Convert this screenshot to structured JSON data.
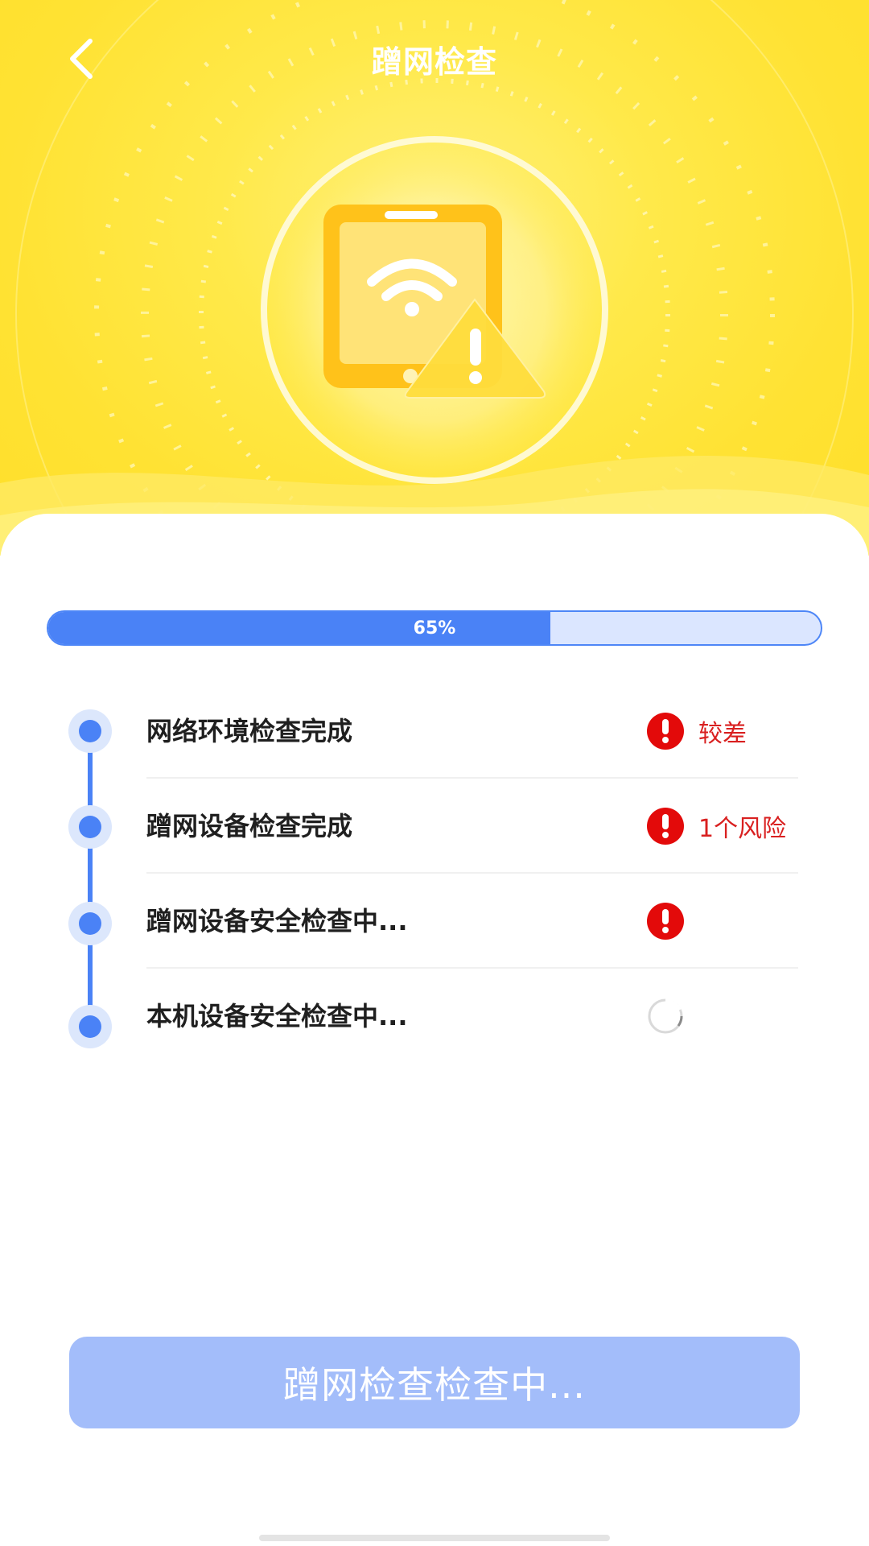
{
  "header": {
    "title": "蹭网检查",
    "back_icon": "chevron-left-icon"
  },
  "hero": {
    "icon": "phone-wifi-warning-icon",
    "colors": {
      "phone": "#ffc21a",
      "screen": "#ffe377",
      "warning": "#ffdc3c"
    }
  },
  "progress": {
    "value": 65,
    "label": "65%",
    "fill_color": "#4a82f6",
    "track_color": "#dbe6ff"
  },
  "checks": [
    {
      "label": "网络环境检查完成",
      "status": "warning",
      "status_text": "较差"
    },
    {
      "label": "蹭网设备检查完成",
      "status": "warning",
      "status_text": "1个风险"
    },
    {
      "label": "蹭网设备安全检查中...",
      "status": "warning",
      "status_text": ""
    },
    {
      "label": "本机设备安全检查中...",
      "status": "loading",
      "status_text": ""
    }
  ],
  "action_button": {
    "label": "蹭网检查检查中..."
  },
  "colors": {
    "accent": "#4a82f6",
    "warning": "#e30a0a",
    "warning_text": "#d92020",
    "header_bg": "#ffe233"
  }
}
